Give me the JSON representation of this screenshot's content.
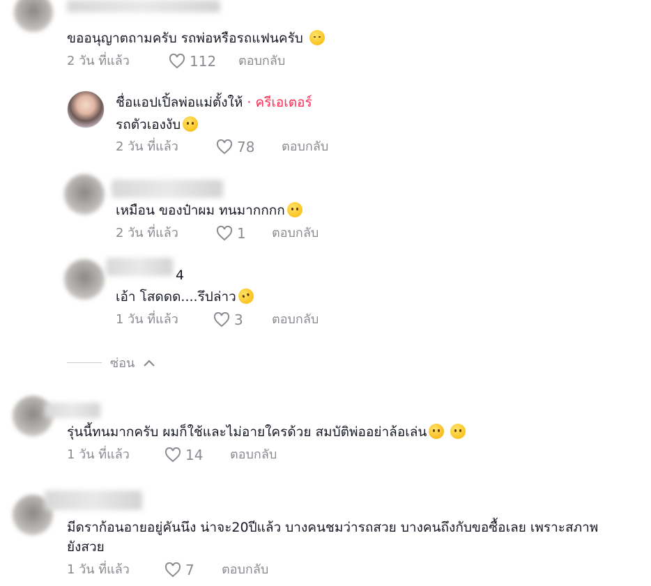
{
  "comments": [
    {
      "text": "ขออนุญาตถามครับ รถพ่อหรือรถแฟนครับ",
      "emoji": "kissing-face-icon",
      "time": "2 วัน ที่แล้ว",
      "likes": "112",
      "reply": "ตอบกลับ"
    },
    {
      "name": "ชื่อแอปเปิ้ลพ่อแม่ตั้งให้",
      "creator_tag": " · ครีเอเตอร์",
      "text": "รถตัวเองงับ",
      "emoji": "smiling-face-icon",
      "time": "2 วัน ที่แล้ว",
      "likes": "78",
      "reply": "ตอบกลับ"
    },
    {
      "text": "เหมือน ของป๋าผม ทนมากกกก",
      "emoji": "smiling-face-icon",
      "time": "2 วัน ที่แล้ว",
      "likes": "1",
      "reply": "ตอบกลับ"
    },
    {
      "name_partial": "4",
      "text": "เอ้า โสดดด....รึปล่าว",
      "emoji": "laughing-face-icon",
      "time": "1 วัน ที่แล้ว",
      "likes": "3",
      "reply": "ตอบกลับ"
    },
    {
      "text": "รุ่นนี้ทนมากครับ ผมก็ใช้และไม่อายใครด้วย สมบัติพ่ออย่าล้อเล่น",
      "emoji": "smiling-sweat-icon",
      "emoji2": "smiling-face-icon",
      "time": "1 วัน ที่แล้ว",
      "likes": "14",
      "reply": "ตอบกลับ"
    },
    {
      "text": "มีดราก้อนอายอยู่คันนึง น่าจะ20ปีแล้ว บางคนชมว่ารถสวย บางคนถึงกับขอซื้อเลย เพราะสภาพ",
      "text2": "ยังสวย",
      "time": "1 วัน ที่แล้ว",
      "likes": "7",
      "reply": "ตอบกลับ"
    }
  ],
  "hide_label": "ซ่อน",
  "colors": {
    "creator": "#fe2c55",
    "meta": "#8a8b91",
    "text": "#161823"
  }
}
